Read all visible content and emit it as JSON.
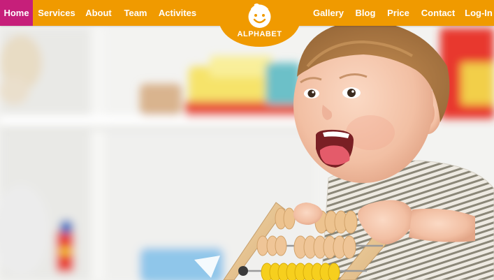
{
  "nav": {
    "left": [
      {
        "label": "Home",
        "active": true
      },
      {
        "label": "Services"
      },
      {
        "label": "About"
      },
      {
        "label": "Team"
      },
      {
        "label": "Activites"
      }
    ],
    "right": [
      {
        "label": "Gallery"
      },
      {
        "label": "Blog"
      },
      {
        "label": "Price"
      },
      {
        "label": "Contact"
      },
      {
        "label": "Log-In"
      }
    ]
  },
  "logo": {
    "text": "ALPHABET",
    "icon": "smiling-child-face-icon"
  },
  "hero": {
    "image": "laughing-baby-with-wooden-abacus"
  },
  "colors": {
    "nav_background": "#f09a00",
    "active_item": "#c61f7a",
    "text": "#ffffff"
  }
}
